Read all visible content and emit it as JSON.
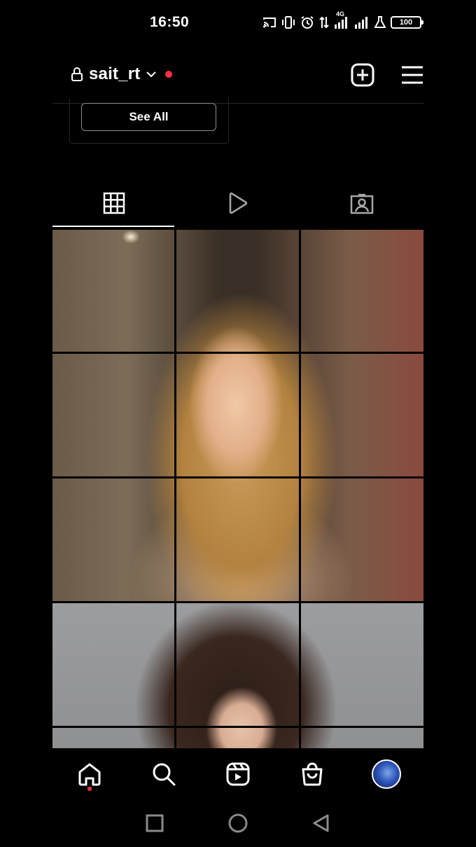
{
  "status_bar": {
    "time": "16:50",
    "network": "4G",
    "battery": "100",
    "icons": [
      "cast-icon",
      "vibrate-icon",
      "alarm-icon",
      "data-transfer-icon",
      "signal-icon",
      "signal-icon",
      "lab-icon",
      "battery-icon"
    ]
  },
  "header": {
    "username": "sait_rt",
    "icons": [
      "lock-icon",
      "chevron-down-icon",
      "notification-dot",
      "new-post-icon",
      "menu-icon"
    ]
  },
  "suggestions": {
    "see_all_label": "See All"
  },
  "profile_tabs": [
    {
      "name": "grid",
      "icon": "grid-icon",
      "active": true
    },
    {
      "name": "reels",
      "icon": "reels-play-icon",
      "active": false
    },
    {
      "name": "tagged",
      "icon": "tagged-icon",
      "active": false
    }
  ],
  "bottom_nav": [
    {
      "name": "home",
      "icon": "home-icon",
      "active": true
    },
    {
      "name": "search",
      "icon": "search-icon",
      "active": false
    },
    {
      "name": "reels",
      "icon": "reels-icon",
      "active": false
    },
    {
      "name": "shop",
      "icon": "shop-icon",
      "active": false
    },
    {
      "name": "profile",
      "icon": "avatar",
      "active": false
    }
  ],
  "system_nav": [
    "recents-square-icon",
    "home-circle-icon",
    "back-triangle-icon"
  ],
  "colors": {
    "background": "#000000",
    "accent_red": "#ff3040",
    "divider": "#262626"
  }
}
